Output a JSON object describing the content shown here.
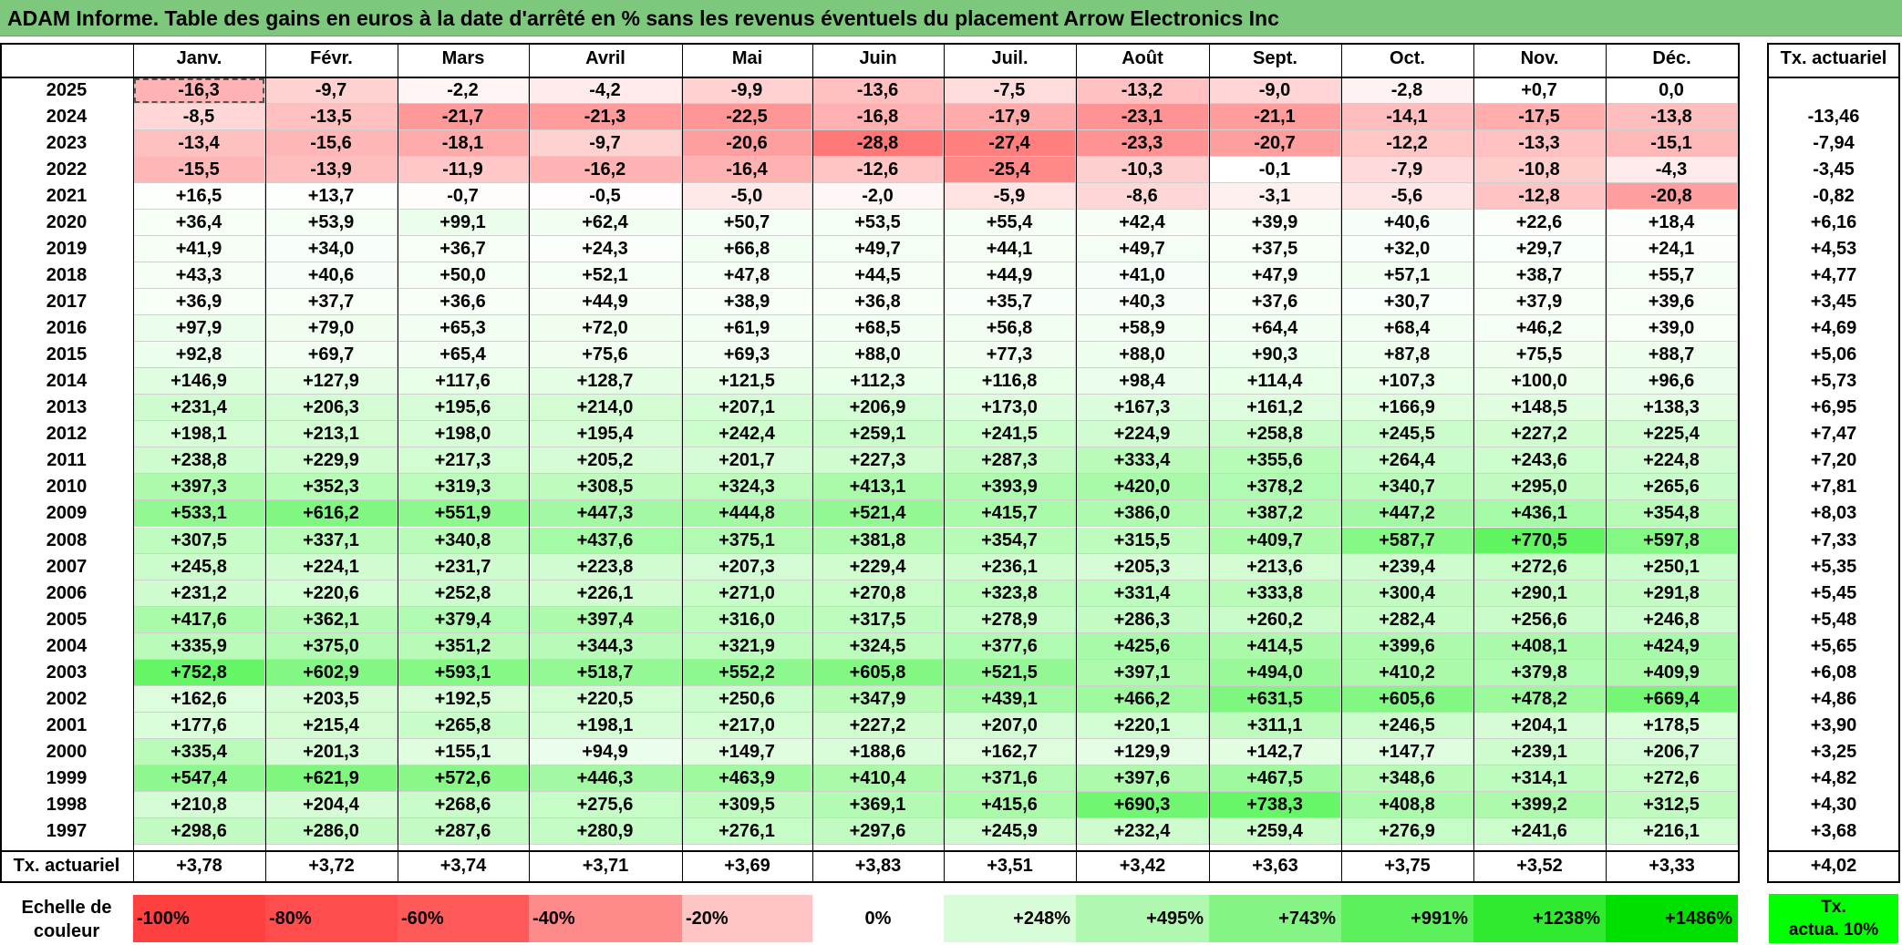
{
  "title": "ADAM Informe. Table des gains en euros à la date d'arrêté en % sans les revenus éventuels du placement Arrow Electronics Inc",
  "months": [
    "Janv.",
    "Févr.",
    "Mars",
    "Avril",
    "Mai",
    "Juin",
    "Juil.",
    "Août",
    "Sept.",
    "Oct.",
    "Nov.",
    "Déc."
  ],
  "tx_header": "Tx. actuariel",
  "rows": [
    {
      "year": "2025",
      "v": [
        "-16,3",
        "-9,7",
        "-2,2",
        "-4,2",
        "-9,9",
        "-13,6",
        "-7,5",
        "-13,2",
        "-9,0",
        "-2,8",
        "+0,7",
        "0,0"
      ],
      "tx": ""
    },
    {
      "year": "2024",
      "v": [
        "-8,5",
        "-13,5",
        "-21,7",
        "-21,3",
        "-22,5",
        "-16,8",
        "-17,9",
        "-23,1",
        "-21,1",
        "-14,1",
        "-17,5",
        "-13,8"
      ],
      "tx": "-13,46"
    },
    {
      "year": "2023",
      "v": [
        "-13,4",
        "-15,6",
        "-18,1",
        "-9,7",
        "-20,6",
        "-28,8",
        "-27,4",
        "-23,3",
        "-20,7",
        "-12,2",
        "-13,3",
        "-15,1"
      ],
      "tx": "-7,94"
    },
    {
      "year": "2022",
      "v": [
        "-15,5",
        "-13,9",
        "-11,9",
        "-16,2",
        "-16,4",
        "-12,6",
        "-25,4",
        "-10,3",
        "-0,1",
        "-7,9",
        "-10,8",
        "-4,3"
      ],
      "tx": "-3,45"
    },
    {
      "year": "2021",
      "v": [
        "+16,5",
        "+13,7",
        "-0,7",
        "-0,5",
        "-5,0",
        "-2,0",
        "-5,9",
        "-8,6",
        "-3,1",
        "-5,6",
        "-12,8",
        "-20,8"
      ],
      "tx": "-0,82"
    },
    {
      "year": "2020",
      "v": [
        "+36,4",
        "+53,9",
        "+99,1",
        "+62,4",
        "+50,7",
        "+53,5",
        "+55,4",
        "+42,4",
        "+39,9",
        "+40,6",
        "+22,6",
        "+18,4"
      ],
      "tx": "+6,16"
    },
    {
      "year": "2019",
      "v": [
        "+41,9",
        "+34,0",
        "+36,7",
        "+24,3",
        "+66,8",
        "+49,7",
        "+44,1",
        "+49,7",
        "+37,5",
        "+32,0",
        "+29,7",
        "+24,1"
      ],
      "tx": "+4,53"
    },
    {
      "year": "2018",
      "v": [
        "+43,3",
        "+40,6",
        "+50,0",
        "+52,1",
        "+47,8",
        "+44,5",
        "+44,9",
        "+41,0",
        "+47,9",
        "+57,1",
        "+38,7",
        "+55,7"
      ],
      "tx": "+4,77"
    },
    {
      "year": "2017",
      "v": [
        "+36,9",
        "+37,7",
        "+36,6",
        "+44,9",
        "+38,9",
        "+36,8",
        "+35,7",
        "+40,3",
        "+37,6",
        "+30,7",
        "+37,9",
        "+39,6"
      ],
      "tx": "+3,45"
    },
    {
      "year": "2016",
      "v": [
        "+97,9",
        "+79,0",
        "+65,3",
        "+72,0",
        "+61,9",
        "+68,5",
        "+56,8",
        "+58,9",
        "+64,4",
        "+68,4",
        "+46,2",
        "+39,0"
      ],
      "tx": "+4,69"
    },
    {
      "year": "2015",
      "v": [
        "+92,8",
        "+69,7",
        "+65,4",
        "+75,6",
        "+69,3",
        "+88,0",
        "+77,3",
        "+88,0",
        "+90,3",
        "+87,8",
        "+75,5",
        "+88,7"
      ],
      "tx": "+5,06"
    },
    {
      "year": "2014",
      "v": [
        "+146,9",
        "+127,9",
        "+117,6",
        "+128,7",
        "+121,5",
        "+112,3",
        "+116,8",
        "+98,4",
        "+114,4",
        "+107,3",
        "+100,0",
        "+96,6"
      ],
      "tx": "+5,73"
    },
    {
      "year": "2013",
      "v": [
        "+231,4",
        "+206,3",
        "+195,6",
        "+214,0",
        "+207,1",
        "+206,9",
        "+173,0",
        "+167,3",
        "+161,2",
        "+166,9",
        "+148,5",
        "+138,3"
      ],
      "tx": "+6,95"
    },
    {
      "year": "2012",
      "v": [
        "+198,1",
        "+213,1",
        "+198,0",
        "+195,4",
        "+242,4",
        "+259,1",
        "+241,5",
        "+224,9",
        "+258,8",
        "+245,5",
        "+227,2",
        "+225,4"
      ],
      "tx": "+7,47"
    },
    {
      "year": "2011",
      "v": [
        "+238,8",
        "+229,9",
        "+217,3",
        "+205,2",
        "+201,7",
        "+227,3",
        "+287,3",
        "+333,4",
        "+355,6",
        "+264,4",
        "+243,6",
        "+224,8"
      ],
      "tx": "+7,20"
    },
    {
      "year": "2010",
      "v": [
        "+397,3",
        "+352,3",
        "+319,3",
        "+308,5",
        "+324,3",
        "+413,1",
        "+393,9",
        "+420,0",
        "+378,2",
        "+340,7",
        "+295,0",
        "+265,6"
      ],
      "tx": "+7,81"
    },
    {
      "year": "2009",
      "v": [
        "+533,1",
        "+616,2",
        "+551,9",
        "+447,3",
        "+444,8",
        "+521,4",
        "+415,7",
        "+386,0",
        "+387,2",
        "+447,2",
        "+436,1",
        "+354,8"
      ],
      "tx": "+8,03"
    },
    {
      "year": "2008",
      "v": [
        "+307,5",
        "+337,1",
        "+340,8",
        "+437,6",
        "+375,1",
        "+381,8",
        "+354,7",
        "+315,5",
        "+409,7",
        "+587,7",
        "+770,5",
        "+597,8"
      ],
      "tx": "+7,33"
    },
    {
      "year": "2007",
      "v": [
        "+245,8",
        "+224,1",
        "+231,7",
        "+223,8",
        "+207,3",
        "+229,4",
        "+236,1",
        "+205,3",
        "+213,6",
        "+239,4",
        "+272,6",
        "+250,1"
      ],
      "tx": "+5,35"
    },
    {
      "year": "2006",
      "v": [
        "+231,2",
        "+220,6",
        "+252,8",
        "+226,1",
        "+271,0",
        "+270,8",
        "+323,8",
        "+331,4",
        "+333,8",
        "+300,4",
        "+290,1",
        "+291,8"
      ],
      "tx": "+5,45"
    },
    {
      "year": "2005",
      "v": [
        "+417,6",
        "+362,1",
        "+379,4",
        "+397,4",
        "+316,0",
        "+317,5",
        "+278,9",
        "+286,3",
        "+260,2",
        "+282,4",
        "+256,6",
        "+246,8"
      ],
      "tx": "+5,48"
    },
    {
      "year": "2004",
      "v": [
        "+335,9",
        "+375,0",
        "+351,2",
        "+344,3",
        "+321,9",
        "+324,5",
        "+377,6",
        "+425,6",
        "+414,5",
        "+399,6",
        "+408,1",
        "+424,9"
      ],
      "tx": "+5,65"
    },
    {
      "year": "2003",
      "v": [
        "+752,8",
        "+602,9",
        "+593,1",
        "+518,7",
        "+552,2",
        "+605,8",
        "+521,5",
        "+397,1",
        "+494,0",
        "+410,2",
        "+379,8",
        "+409,9"
      ],
      "tx": "+6,08"
    },
    {
      "year": "2002",
      "v": [
        "+162,6",
        "+203,5",
        "+192,5",
        "+220,5",
        "+250,6",
        "+347,9",
        "+439,1",
        "+466,2",
        "+631,5",
        "+605,6",
        "+478,2",
        "+669,4"
      ],
      "tx": "+4,86"
    },
    {
      "year": "2001",
      "v": [
        "+177,6",
        "+215,4",
        "+265,8",
        "+198,1",
        "+217,0",
        "+227,2",
        "+207,0",
        "+220,1",
        "+311,1",
        "+246,5",
        "+204,1",
        "+178,5"
      ],
      "tx": "+3,90"
    },
    {
      "year": "2000",
      "v": [
        "+335,4",
        "+201,3",
        "+155,1",
        "+94,9",
        "+149,7",
        "+188,6",
        "+162,7",
        "+129,9",
        "+142,7",
        "+147,7",
        "+239,1",
        "+206,7"
      ],
      "tx": "+3,25"
    },
    {
      "year": "1999",
      "v": [
        "+547,4",
        "+621,9",
        "+572,6",
        "+446,3",
        "+463,9",
        "+410,4",
        "+371,6",
        "+397,6",
        "+467,5",
        "+348,6",
        "+314,1",
        "+272,6"
      ],
      "tx": "+4,82"
    },
    {
      "year": "1998",
      "v": [
        "+210,8",
        "+204,4",
        "+268,6",
        "+275,6",
        "+309,5",
        "+369,1",
        "+415,6",
        "+690,3",
        "+738,3",
        "+408,8",
        "+399,2",
        "+312,5"
      ],
      "tx": "+4,30"
    },
    {
      "year": "1997",
      "v": [
        "+298,6",
        "+286,0",
        "+287,6",
        "+280,9",
        "+276,1",
        "+297,6",
        "+245,9",
        "+232,4",
        "+259,4",
        "+276,9",
        "+241,6",
        "+216,1"
      ],
      "tx": "+3,68"
    }
  ],
  "footer": {
    "label": "Tx. actuariel",
    "values": [
      "+3,78",
      "+3,72",
      "+3,74",
      "+3,71",
      "+3,69",
      "+3,83",
      "+3,51",
      "+3,42",
      "+3,63",
      "+3,75",
      "+3,52",
      "+3,33"
    ],
    "total": "+4,02"
  },
  "scale": {
    "label_line1": "Echelle de",
    "label_line2": "couleur",
    "items": [
      {
        "text": "-100%",
        "color": "#ff4040",
        "align": "left"
      },
      {
        "text": "-80%",
        "color": "#ff4d4d",
        "align": "left"
      },
      {
        "text": "-60%",
        "color": "#ff5a5a",
        "align": "left"
      },
      {
        "text": "-40%",
        "color": "#ff8a8a",
        "align": "left"
      },
      {
        "text": "-20%",
        "color": "#ffc4c4",
        "align": "left"
      },
      {
        "text": "0%",
        "color": "#ffffff",
        "align": "center"
      },
      {
        "text": "+248%",
        "color": "#d8fcd8",
        "align": "right"
      },
      {
        "text": "+495%",
        "color": "#b0f8b0",
        "align": "right"
      },
      {
        "text": "+743%",
        "color": "#84f584",
        "align": "right"
      },
      {
        "text": "+991%",
        "color": "#5cf05c",
        "align": "right"
      },
      {
        "text": "+1238%",
        "color": "#30ea30",
        "align": "right"
      },
      {
        "text": "+1486%",
        "color": "#00e000",
        "align": "right"
      }
    ],
    "tx_line1": "Tx.",
    "tx_line2": "actua. 10%",
    "tx_color": "#00ff00"
  }
}
